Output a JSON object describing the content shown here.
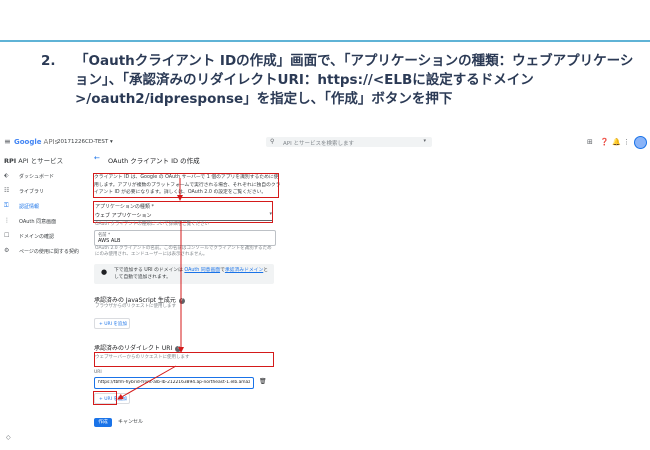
{
  "slide": {
    "step_number": "2.",
    "step_text": "「Oauthクライアント IDの作成」画面で、「アプリケーションの種類：ウェブアプリケーション」、「承認済みのリダイレクトURI：https://<ELBに設定するドメイン>/oauth2/idpresponse」を指定し、「作成」ボタンを押下"
  },
  "topbar": {
    "logo": "Google",
    "logo_suffix": "APIs",
    "project": "20171226CD-TEST ▾",
    "search_placeholder": "API とサービスを検索します"
  },
  "sidebar": {
    "section_icon": "RPI",
    "section_label": "API とサービス",
    "items": [
      {
        "label": "ダッシュボード",
        "icon": "dashboard-icon",
        "active": false
      },
      {
        "label": "ライブラリ",
        "icon": "library-icon",
        "active": false
      },
      {
        "label": "認証情報",
        "icon": "key-icon",
        "active": true
      },
      {
        "label": "OAuth 同意画面",
        "icon": "consent-icon",
        "active": false
      },
      {
        "label": "ドメインの確認",
        "icon": "domain-icon",
        "active": false
      },
      {
        "label": "ページの使用に関する契約",
        "icon": "agreement-icon",
        "active": false
      }
    ]
  },
  "main": {
    "title": "OAuth クライアント ID の作成",
    "intro": "クライアント ID は、Google の OAuth サーバーで 1 個のアプリを識別するために使用します。アプリが複数のプラットフォームで実行される場合、それぞれに独自のクライアント ID が必要になります。詳しくは、OAuth 2.0 の設定をご覧ください。",
    "app_type_label": "アプリケーションの種類 *",
    "app_type_value": "ウェブ アプリケーション",
    "app_type_helper": "OAuth クライアントの種類について詳細をご覧ください",
    "name_label": "名前 *",
    "name_value": "AWS ALB",
    "name_helper": "OAuth 2.0 クライアントの名前。この名前はコンソールでクライアントを識別するためにのみ使用され、エンドユーザーには表示されません。",
    "info_pre": "下で追加する URI のドメインは",
    "info_link1": "OAuth 同意画面",
    "info_mid": "で",
    "info_link2": "承認済みドメイン",
    "info_post": "として自動で追加されます。",
    "js_origin_title": "承認済みの JavaScript 生成元",
    "js_origin_help": "?",
    "js_origin_helper": "ブラウザからのリクエストに使用します",
    "add_uri_label": "+ URI を追加",
    "redirect_title": "承認済みのリダイレクト URI",
    "redirect_help": "?",
    "redirect_helper": "ウェブサーバーからのリクエストに使用します",
    "uri_label": "URI",
    "uri_value": "https://tbfm-hybrid-front-alb-lb-2122163894.ap-northeast-1.elb.amazonaws.c",
    "add_uri_label2": "+ URI を追加",
    "create_label": "作成",
    "cancel_label": "キャンセル"
  },
  "colors": {
    "accent": "#1a73e8",
    "highlight": "#d41a1a",
    "slide_line": "#5fb3d6",
    "heading": "#2b3a55"
  }
}
